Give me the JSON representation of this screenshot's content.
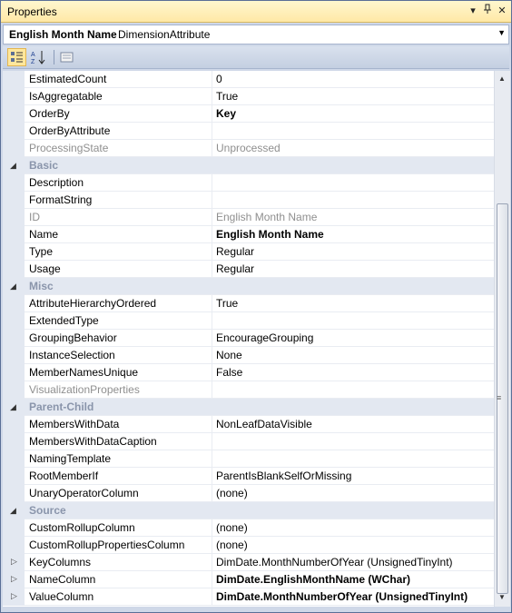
{
  "window": {
    "title": "Properties"
  },
  "object_selector": {
    "name": "English Month Name",
    "type": "DimensionAttribute"
  },
  "toolbar": {
    "categorized_icon": "categorized-icon",
    "alphabetical_icon": "alphabetical-icon",
    "property_pages_icon": "property-pages-icon"
  },
  "rows": [
    {
      "name": "EstimatedCount",
      "value": "0"
    },
    {
      "name": "IsAggregatable",
      "value": "True"
    },
    {
      "name": "OrderBy",
      "value": "Key"
    },
    {
      "name": "OrderByAttribute",
      "value": ""
    },
    {
      "name": "ProcessingState",
      "value": "Unprocessed"
    },
    {
      "name": "Basic",
      "value": ""
    },
    {
      "name": "Description",
      "value": ""
    },
    {
      "name": "FormatString",
      "value": ""
    },
    {
      "name": "ID",
      "value": "English Month Name"
    },
    {
      "name": "Name",
      "value": "English Month Name"
    },
    {
      "name": "Type",
      "value": "Regular"
    },
    {
      "name": "Usage",
      "value": "Regular"
    },
    {
      "name": "Misc",
      "value": ""
    },
    {
      "name": "AttributeHierarchyOrdered",
      "value": "True"
    },
    {
      "name": "ExtendedType",
      "value": ""
    },
    {
      "name": "GroupingBehavior",
      "value": "EncourageGrouping"
    },
    {
      "name": "InstanceSelection",
      "value": "None"
    },
    {
      "name": "MemberNamesUnique",
      "value": "False"
    },
    {
      "name": "VisualizationProperties",
      "value": ""
    },
    {
      "name": "Parent-Child",
      "value": ""
    },
    {
      "name": "MembersWithData",
      "value": "NonLeafDataVisible"
    },
    {
      "name": "MembersWithDataCaption",
      "value": ""
    },
    {
      "name": "NamingTemplate",
      "value": ""
    },
    {
      "name": "RootMemberIf",
      "value": "ParentIsBlankSelfOrMissing"
    },
    {
      "name": "UnaryOperatorColumn",
      "value": "(none)"
    },
    {
      "name": "Source",
      "value": ""
    },
    {
      "name": "CustomRollupColumn",
      "value": "(none)"
    },
    {
      "name": "CustomRollupPropertiesColumn",
      "value": "(none)"
    },
    {
      "name": "KeyColumns",
      "value": "DimDate.MonthNumberOfYear (UnsignedTinyInt)"
    },
    {
      "name": "NameColumn",
      "value": "DimDate.EnglishMonthName (WChar)"
    },
    {
      "name": "ValueColumn",
      "value": "DimDate.MonthNumberOfYear (UnsignedTinyInt)"
    }
  ]
}
